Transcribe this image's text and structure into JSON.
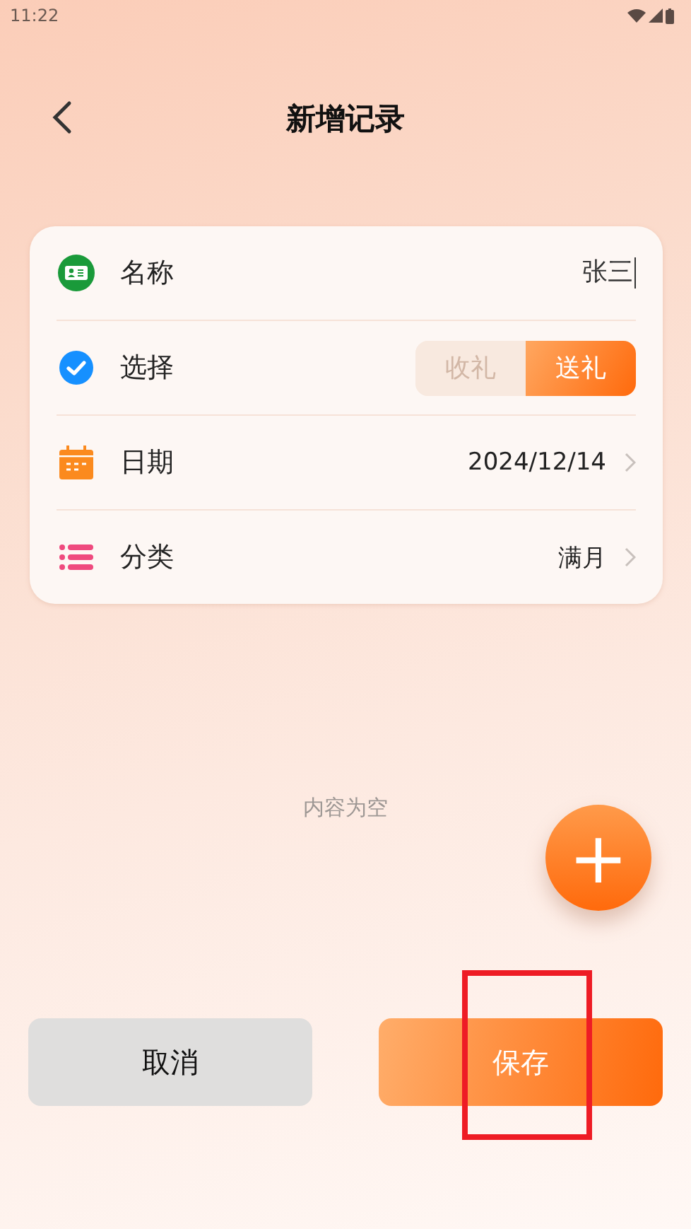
{
  "status_bar": {
    "time": "11:22"
  },
  "header": {
    "title": "新增记录"
  },
  "form": {
    "rows": [
      {
        "kind": "input",
        "label": "名称",
        "value": "张三",
        "caret": true
      },
      {
        "kind": "segmented",
        "label": "选择",
        "options": [
          {
            "label": "收礼",
            "selected": false
          },
          {
            "label": "送礼",
            "selected": true
          }
        ]
      },
      {
        "kind": "picker",
        "label": "日期",
        "value": "2024/12/14"
      },
      {
        "kind": "picker",
        "label": "分类",
        "value": "满月"
      }
    ]
  },
  "empty_text": "内容为空",
  "fab": {
    "label": "+"
  },
  "buttons": [
    {
      "kind": "cancel",
      "label": "取消",
      "highlighted": false
    },
    {
      "kind": "save",
      "label": "保存",
      "highlighted": true
    }
  ]
}
